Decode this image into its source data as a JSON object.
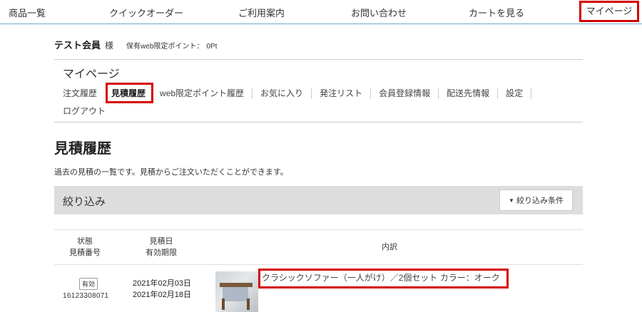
{
  "topnav": {
    "items": [
      "商品一覧",
      "クイックオーダー",
      "ご利用案内",
      "お問い合わせ",
      "カートを見る"
    ],
    "mypage": "マイページ"
  },
  "member": {
    "name": "テスト会員",
    "suffix": "様",
    "points_label": "保有web限定ポイント：",
    "points_value": "0Pt"
  },
  "mypage_title": "マイページ",
  "subnav": {
    "items": [
      "注文履歴",
      "見積履歴",
      "web限定ポイント履歴",
      "お気に入り",
      "発注リスト",
      "会員登録情報",
      "配送先情報",
      "設定"
    ],
    "logout": "ログアウト"
  },
  "page": {
    "title": "見積履歴",
    "description": "過去の見積の一覧です。見積からご注文いただくことができます。"
  },
  "filter": {
    "label": "絞り込み",
    "button": "絞り込み条件"
  },
  "table": {
    "headers": {
      "status": "状態",
      "quote_number": "見積番号",
      "quote_date": "見積日",
      "expiry": "有効期限",
      "details": "内訳"
    },
    "rows": [
      {
        "status": "有効",
        "quote_number": "16123308071",
        "quote_date": "2021年02月03日",
        "expiry": "2021年02月18日",
        "item": "クラシックソファー（一人がけ）／2個セット カラー：オーク"
      }
    ]
  },
  "colors": {
    "highlight": "#d40000",
    "nav_border": "#6fa7c7",
    "filter_bg": "#dddddd"
  }
}
